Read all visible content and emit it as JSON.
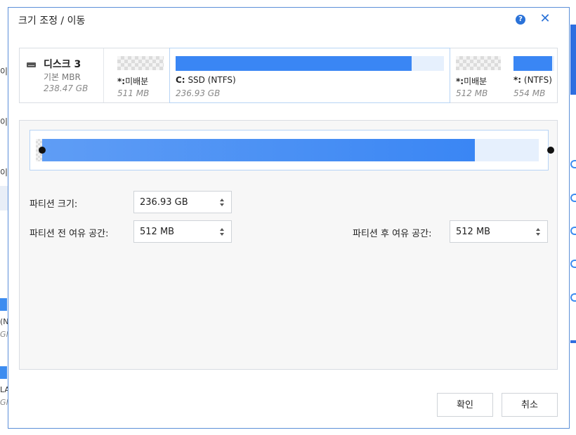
{
  "dialog": {
    "title": "크기 조정 / 이동"
  },
  "disk": {
    "name": "디스크 3",
    "type": "기본 MBR",
    "size": "238.47 GB"
  },
  "partitions": [
    {
      "id": "unalloc-1",
      "letter": "*:",
      "label": "미배분",
      "size": "511 MB",
      "used_fraction": 0
    },
    {
      "id": "c-drive",
      "letter": "C:",
      "label": "SSD (NTFS)",
      "size": "236.93 GB",
      "used_fraction": 0.88
    },
    {
      "id": "unalloc-2",
      "letter": "*:",
      "label": "미배분",
      "size": "512 MB",
      "used_fraction": 0
    },
    {
      "id": "ntfs-small",
      "letter": "*:",
      "label": "(NTFS)",
      "size": "554 MB",
      "used_fraction": 0.95
    }
  ],
  "resizer": {
    "free_before_fraction": 0.002,
    "partition_fraction": 0.86,
    "free_after_fraction": 0.138
  },
  "fields": {
    "partition_size_label": "파티션 크기:",
    "partition_size_value": "236.93 GB",
    "free_before_label": "파티션 전 여유 공간:",
    "free_before_value": "512 MB",
    "free_after_label": "파티션 후 여유 공간:",
    "free_after_value": "512 MB"
  },
  "buttons": {
    "ok": "확인",
    "cancel": "취소"
  },
  "background": {
    "left_text_1": "이",
    "left_text_2": "이",
    "left_text_3": "이",
    "left_text_4": "(N",
    "left_text_5": "Gl",
    "left_text_6": "LA",
    "left_text_7": "Gl"
  },
  "colors": {
    "accent": "#2a72d8",
    "partition_fill": "#3a86f4",
    "partition_track": "#e6f0fd",
    "dialog_border": "#5b8fd8"
  }
}
